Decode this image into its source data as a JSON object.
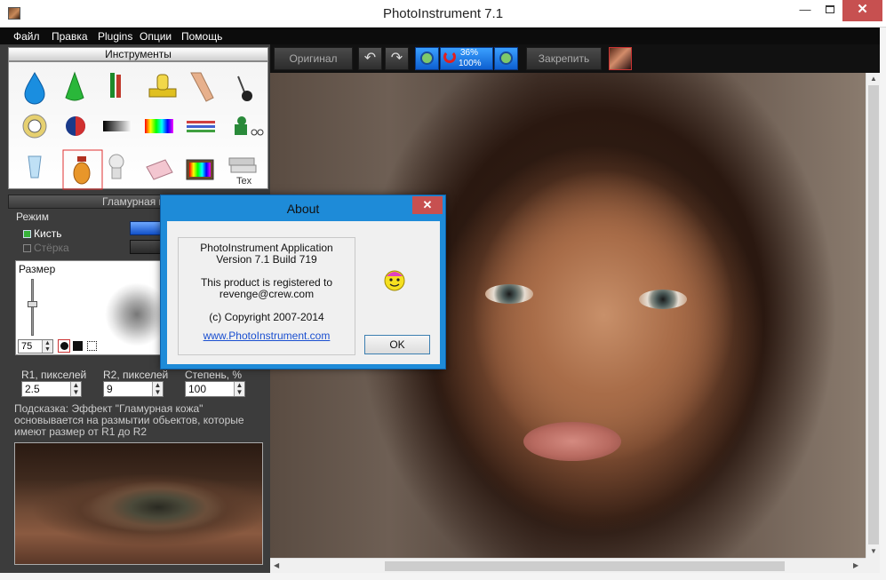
{
  "window": {
    "title": "PhotoInstrument 7.1",
    "min": "—",
    "close": "✕"
  },
  "menu": [
    "Файл",
    "Правка",
    "Plugins",
    "Опции",
    "Помощь"
  ],
  "toolbar": {
    "original": "Оригинал",
    "undo": "↶",
    "redo": "↷",
    "zoom_top": "36%",
    "zoom_bottom": "100%",
    "pin": "Закрепить"
  },
  "tools_panel": {
    "header": "Инструменты"
  },
  "glamour_panel": {
    "header": "Гламурная ко",
    "mode_label": "Режим",
    "brush_label": "Кисть",
    "eraser_label": "Стёрка",
    "size_label": "Размер",
    "size_value": "75",
    "r1_label": "R1, пикселей",
    "r1_value": "2.5",
    "r2_label": "R2, пикселей",
    "r2_value": "9",
    "degree_label": "Степень, %",
    "degree_value": "100",
    "hint": "Подсказка: Эффект \"Гламурная кожа\" основывается на размытии обьектов, которые имеют размер от R1 до R2"
  },
  "about": {
    "title": "About",
    "close": "✕",
    "app_name": "PhotoInstrument Application",
    "version": "Version 7.1 Build 719",
    "registered_line1": "This product is registered to",
    "registered_line2": "revenge@crew.com",
    "copyright": "(c) Copyright 2007-2014",
    "link": "www.PhotoInstrument.com",
    "ok": "OK"
  },
  "colors": {
    "accent": "#1e8bd8",
    "close": "#c75050",
    "panel": "#3c3c3c"
  }
}
